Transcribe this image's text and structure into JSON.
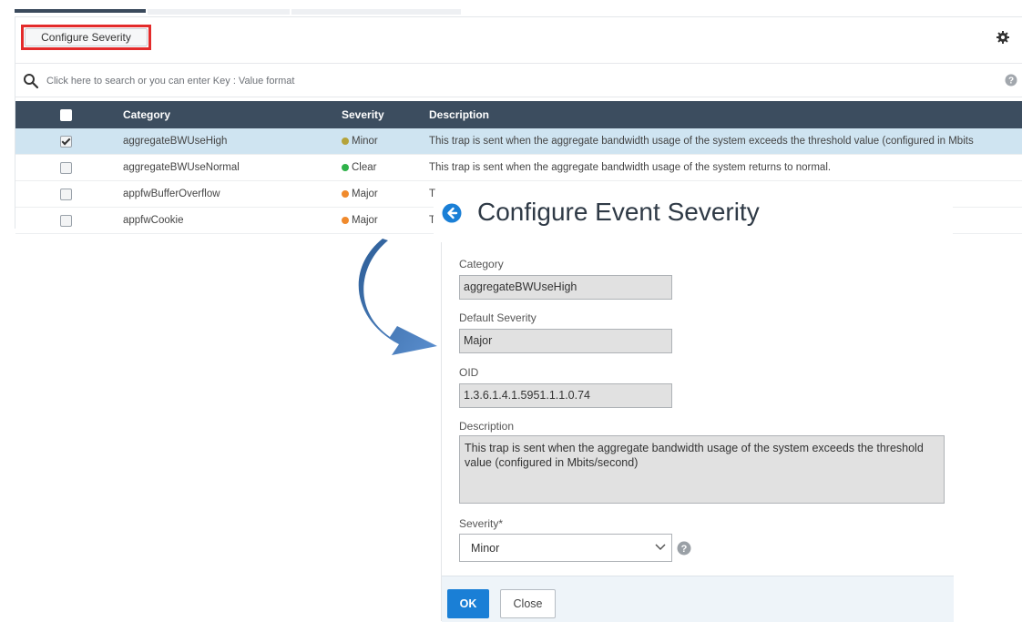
{
  "toolbar": {
    "configure_label": "Configure Severity"
  },
  "search": {
    "placeholder": "Click here to search or you can enter Key : Value format"
  },
  "table": {
    "headers": {
      "category": "Category",
      "severity": "Severity",
      "description": "Description"
    },
    "rows": [
      {
        "category": "aggregateBWUseHigh",
        "severity": "Minor",
        "severity_color": "#b5a33a",
        "description": "This trap is sent when the aggregate bandwidth usage of the system exceeds the threshold value (configured in Mbits",
        "checked": true
      },
      {
        "category": "aggregateBWUseNormal",
        "severity": "Clear",
        "severity_color": "#2fb24a",
        "description": "This trap is sent when the aggregate bandwidth usage of the system returns to normal.",
        "checked": false
      },
      {
        "category": "appfwBufferOverflow",
        "severity": "Major",
        "severity_color": "#f08a2c",
        "description": "T",
        "checked": false
      },
      {
        "category": "appfwCookie",
        "severity": "Major",
        "severity_color": "#f08a2c",
        "description": "T",
        "checked": false
      }
    ]
  },
  "dialog": {
    "title": "Configure Event Severity",
    "category_label": "Category",
    "category_value": "aggregateBWUseHigh",
    "default_severity_label": "Default Severity",
    "default_severity_value": "Major",
    "oid_label": "OID",
    "oid_value": "1.3.6.1.4.1.5951.1.1.0.74",
    "description_label": "Description",
    "description_value": "This trap is sent when the aggregate bandwidth usage of the system exceeds the threshold value (configured in Mbits/second)",
    "severity_label": "Severity*",
    "severity_value": "Minor",
    "ok_label": "OK",
    "close_label": "Close"
  },
  "colors": {
    "header_bg": "#3c4d5f",
    "selected_row": "#cfe4f1",
    "primary_button": "#1a7fd6",
    "highlight_border": "#e32b2b",
    "arrow": "#3f73ad"
  },
  "icons": [
    "gear-icon",
    "search-icon",
    "help-icon",
    "back-arrow-icon",
    "chevron-down-icon",
    "curved-arrow-icon"
  ]
}
